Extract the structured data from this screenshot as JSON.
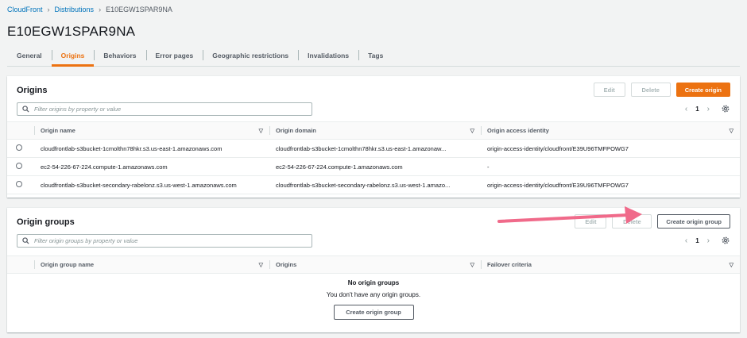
{
  "breadcrumb": {
    "root": "CloudFront",
    "section": "Distributions",
    "current": "E10EGW1SPAR9NA"
  },
  "page_title": "E10EGW1SPAR9NA",
  "tabs": [
    {
      "label": "General",
      "active": false
    },
    {
      "label": "Origins",
      "active": true
    },
    {
      "label": "Behaviors",
      "active": false
    },
    {
      "label": "Error pages",
      "active": false
    },
    {
      "label": "Geographic restrictions",
      "active": false
    },
    {
      "label": "Invalidations",
      "active": false
    },
    {
      "label": "Tags",
      "active": false
    }
  ],
  "origins": {
    "title": "Origins",
    "edit_label": "Edit",
    "delete_label": "Delete",
    "create_label": "Create origin",
    "search_placeholder": "Filter origins by property or value",
    "page": "1",
    "columns": [
      "Origin name",
      "Origin domain",
      "Origin access identity"
    ],
    "rows": [
      [
        "cloudfrontlab-s3bucket-1cmolthn78hkr.s3.us-east-1.amazonaws.com",
        "cloudfrontlab-s3bucket-1cmolthn78hkr.s3.us-east-1.amazonaw...",
        "origin-access-identity/cloudfront/E39U96TMFPOWG7"
      ],
      [
        "ec2-54-226-67-224.compute-1.amazonaws.com",
        "ec2-54-226-67-224.compute-1.amazonaws.com",
        "-"
      ],
      [
        "cloudfrontlab-s3bucket-secondary-rabelonz.s3.us-west-1.amazonaws.com",
        "cloudfrontlab-s3bucket-secondary-rabelonz.s3.us-west-1.amazo...",
        "origin-access-identity/cloudfront/E39U96TMFPOWG7"
      ]
    ]
  },
  "origin_groups": {
    "title": "Origin groups",
    "edit_label": "Edit",
    "delete_label": "Delete",
    "create_label": "Create origin group",
    "search_placeholder": "Filter origin groups by property or value",
    "page": "1",
    "columns": [
      "Origin group name",
      "Origins",
      "Failover criteria"
    ],
    "empty_title": "No origin groups",
    "empty_desc": "You don't have any origin groups.",
    "empty_button": "Create origin group"
  },
  "colors": {
    "accent": "#ec7211",
    "link": "#0073bb",
    "annotation_arrow": "#f06a8a"
  },
  "icons": [
    "search-icon",
    "settings-gear-icon",
    "chevron-left-icon",
    "chevron-right-icon",
    "sort-caret-icon",
    "annotation-arrow"
  ]
}
